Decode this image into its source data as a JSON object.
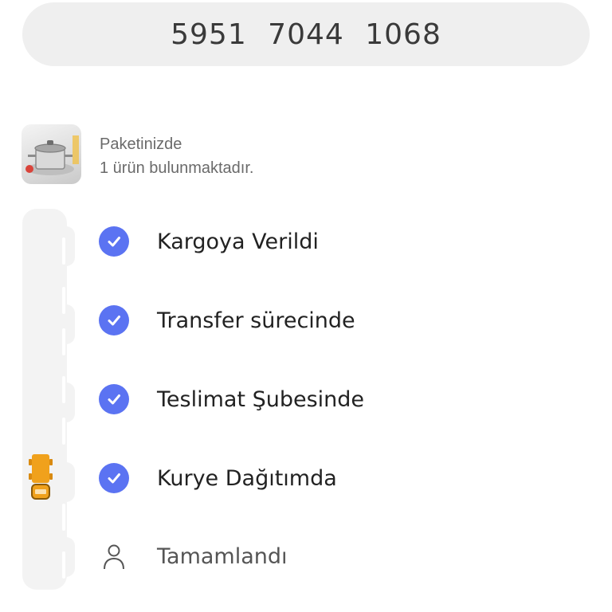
{
  "tracking": {
    "number": "5951  7044  1068"
  },
  "package": {
    "line1": "Paketinizde",
    "line2": "1 ürün bulunmaktadır.",
    "thumbnail_icon": "cookware-product-image"
  },
  "steps": [
    {
      "label": "Kargoya Verildi",
      "status": "done",
      "icon": "check-icon"
    },
    {
      "label": "Transfer sürecinde",
      "status": "done",
      "icon": "check-icon"
    },
    {
      "label": "Teslimat Şubesinde",
      "status": "done",
      "icon": "check-icon"
    },
    {
      "label": "Kurye Dağıtımda",
      "status": "done",
      "icon": "check-icon"
    },
    {
      "label": "Tamamlandı",
      "status": "pending",
      "icon": "person-icon"
    }
  ],
  "colors": {
    "accent": "#5b73f2",
    "pill_bg": "#efefef",
    "road": "#f3f3f3",
    "truck": "#f0a11c"
  }
}
